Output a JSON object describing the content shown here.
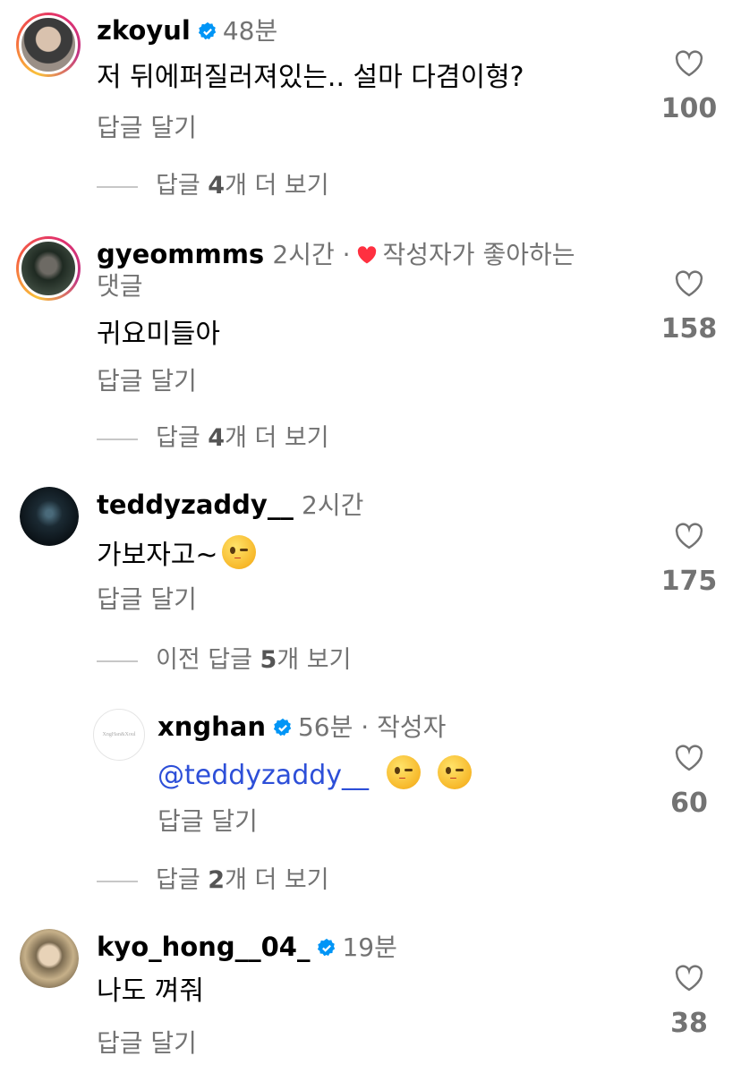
{
  "comments": [
    {
      "username": "zkoyul",
      "verified": true,
      "time": "48분",
      "text": "저 뒤에퍼질러져있는.. 설마 다겸이형?",
      "reply_label": "답글 달기",
      "likes": "100",
      "more_replies": {
        "prefix": "답글 ",
        "count": "4",
        "suffix": "개 더 보기"
      }
    },
    {
      "username": "gyeommms",
      "verified": false,
      "time": "2시간 ·",
      "creator_liked": "작성자가 좋아하는",
      "creator_liked_cont": "댓글",
      "text": "귀요미들아",
      "reply_label": "답글 달기",
      "likes": "158",
      "more_replies": {
        "prefix": "답글 ",
        "count": "4",
        "suffix": "개 더 보기"
      }
    },
    {
      "username": "teddyzaddy__",
      "verified": false,
      "time": "2시간",
      "text": "가보자고~",
      "reply_label": "답글 달기",
      "likes": "175",
      "more_replies": {
        "prefix": "이전 답글 ",
        "count": "5",
        "suffix": "개 보기"
      }
    },
    {
      "username": "xnghan",
      "verified": true,
      "time": "56분 · 작성자",
      "avatar_text": "XngHan&Xoul",
      "mention": "@teddyzaddy__",
      "reply_label": "답글 달기",
      "likes": "60",
      "more_replies": {
        "prefix": "답글 ",
        "count": "2",
        "suffix": "개 더 보기"
      }
    },
    {
      "username": "kyo_hong__04_",
      "verified": true,
      "time": "19분",
      "text": "나도 껴줘",
      "reply_label": "답글 달기",
      "likes": "38"
    }
  ],
  "colors": {
    "verified": "#0095f6",
    "heart_red": "#ff3040",
    "mention": "#2d4fd8",
    "meta_gray": "#737373"
  },
  "icons": [
    "heart-outline-icon",
    "verified-badge-icon",
    "heart-filled-icon",
    "wink-emoji-icon"
  ]
}
